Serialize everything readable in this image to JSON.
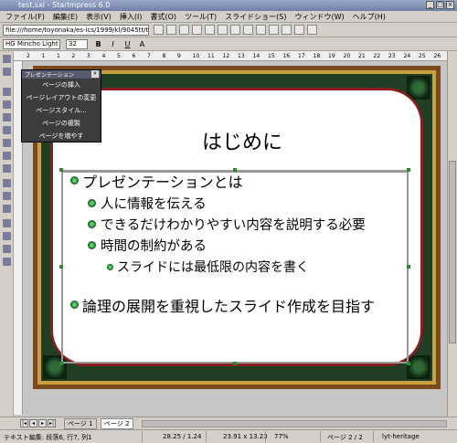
{
  "window": {
    "title": "test.sxi - StarImpress 6.0"
  },
  "menu": [
    "ファイル(F)",
    "編集(E)",
    "表示(V)",
    "挿入(I)",
    "書式(O)",
    "ツール(T)",
    "スライドショー(S)",
    "ウィンドウ(W)",
    "ヘルプ(H)"
  ],
  "url": "file:///home/toyonaka/es-ics/1999/kl/9045tt/test.sxi",
  "font": {
    "name": "HG Mincho Light",
    "size": "32"
  },
  "format_buttons": [
    "B",
    "I",
    "U",
    "A"
  ],
  "ruler": {
    "labels": [
      "2",
      "1",
      "1",
      "2",
      "3",
      "4",
      "5",
      "6",
      "7",
      "8",
      "9",
      "10",
      "11",
      "12",
      "13",
      "14",
      "15",
      "16",
      "17",
      "18",
      "19",
      "20",
      "21",
      "22",
      "23",
      "24",
      "25",
      "26"
    ]
  },
  "panel": {
    "title": "プレゼンテーション",
    "items": [
      "ページの挿入",
      "ページレイアウトの変更",
      "ページスタイル...",
      "ページの複製",
      "ページを増やす"
    ]
  },
  "slide": {
    "title": "はじめに",
    "bullets": [
      {
        "level": 1,
        "text": "プレゼンテーションとは"
      },
      {
        "level": 2,
        "text": "人に情報を伝える"
      },
      {
        "level": 2,
        "text": "できるだけわかりやすい内容を説明する必要"
      },
      {
        "level": 2,
        "text": "時間の制約がある"
      },
      {
        "level": 3,
        "text": "スライドには最低限の内容を書く"
      },
      {
        "level": 1,
        "text": "論理の展開を重視したスライド作成を目指す"
      }
    ]
  },
  "tabs": [
    "ページ 1",
    "ページ 2"
  ],
  "status": {
    "text_edit": "テキスト編集: 段落6, 行7, 列1",
    "position": "28.25 / 1.24",
    "size": "23.91 x 13.23",
    "zoom": "77%",
    "page": "ページ 2 / 2",
    "layout": "lyt-heritage"
  }
}
